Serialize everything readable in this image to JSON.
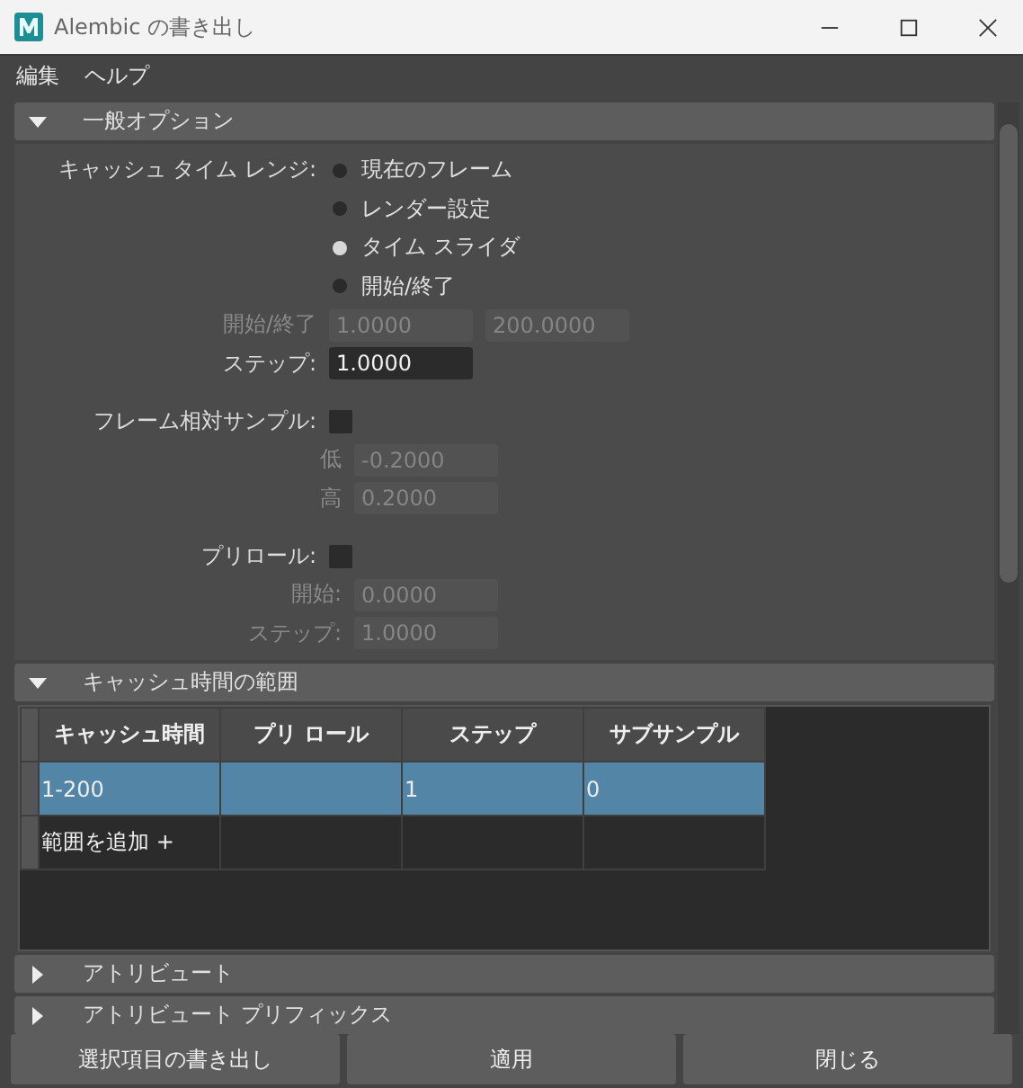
{
  "window": {
    "title": "Alembic の書き出し"
  },
  "menu": [
    {
      "label": "編集"
    },
    {
      "label": "ヘルプ"
    }
  ],
  "sections": [
    {
      "kind": "options",
      "title": "一般オプション",
      "expanded": true,
      "rows": [
        {
          "kind": "radio",
          "label": "キャッシュ タイム レンジ:",
          "text": "現在のフレーム",
          "selected": false
        },
        {
          "kind": "radio",
          "text": "レンダー設定",
          "selected": false
        },
        {
          "kind": "radio",
          "text": "タイム スライダ",
          "selected": true
        },
        {
          "kind": "radio",
          "text": "開始/終了",
          "selected": false
        },
        {
          "kind": "fields",
          "label": "開始/終了",
          "values": [
            "1.0000",
            "200.0000"
          ],
          "disabled": true
        },
        {
          "kind": "fields",
          "label": "ステップ:",
          "values": [
            "1.0000"
          ],
          "disabled": false
        },
        {
          "kind": "checkbox",
          "label": "フレーム相対サンプル:",
          "checked": false
        },
        {
          "kind": "subfield",
          "label": "低",
          "value": "-0.2000",
          "disabled": true
        },
        {
          "kind": "subfield",
          "label": "高",
          "value": "0.2000",
          "disabled": true
        },
        {
          "kind": "checkbox",
          "label": "プリロール:",
          "checked": false
        },
        {
          "kind": "subfield",
          "label": "開始:",
          "value": "0.0000",
          "disabled": true
        },
        {
          "kind": "subfield",
          "label": "ステップ:",
          "value": "1.0000",
          "disabled": true
        }
      ]
    },
    {
      "kind": "table",
      "title": "キャッシュ時間の範囲",
      "expanded": true,
      "columns": [
        "キャッシュ時間",
        "プリ ロール",
        "ステップ",
        "サブサンプル"
      ],
      "rows": [
        {
          "cells": [
            "1-200",
            "",
            "1",
            "0"
          ],
          "selected": true
        },
        {
          "cells": [
            "範囲を追加 +",
            "",
            "",
            ""
          ],
          "selected": false
        }
      ]
    },
    {
      "kind": "header",
      "title": "アトリビュート",
      "expanded": false
    },
    {
      "kind": "header",
      "title": "アトリビュート プリフィックス",
      "expanded": false
    }
  ],
  "buttons": [
    {
      "label": "選択項目の書き出し"
    },
    {
      "label": "適用"
    },
    {
      "label": "閉じる"
    }
  ]
}
